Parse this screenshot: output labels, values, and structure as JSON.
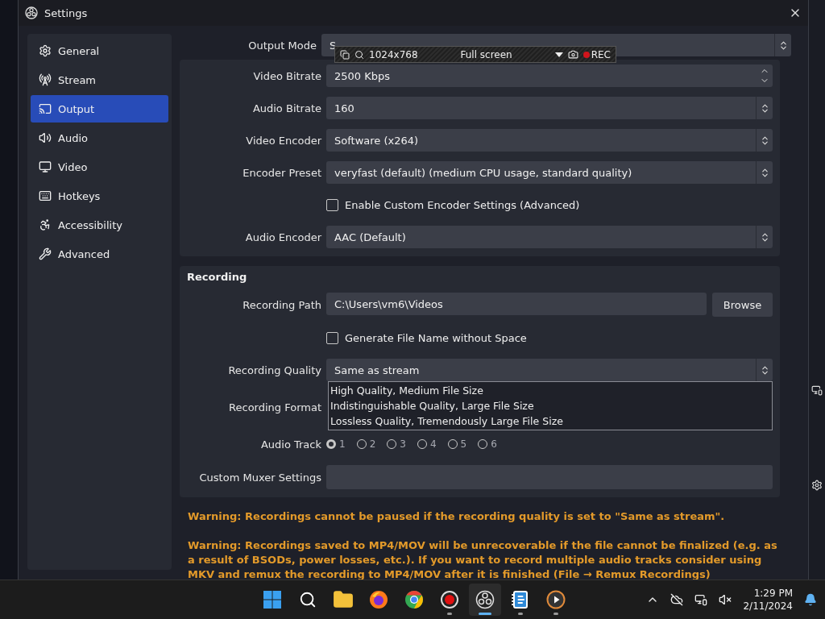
{
  "window": {
    "title": "Settings"
  },
  "sidebar": {
    "items": [
      {
        "label": "General",
        "selected": false
      },
      {
        "label": "Stream",
        "selected": false
      },
      {
        "label": "Output",
        "selected": true
      },
      {
        "label": "Audio",
        "selected": false
      },
      {
        "label": "Video",
        "selected": false
      },
      {
        "label": "Hotkeys",
        "selected": false
      },
      {
        "label": "Accessibility",
        "selected": false
      },
      {
        "label": "Advanced",
        "selected": false
      }
    ]
  },
  "output_mode": {
    "label": "Output Mode",
    "value": "S"
  },
  "streaming": {
    "rows": [
      {
        "kind": "spin",
        "label": "Video Bitrate",
        "value": "2500 Kbps"
      },
      {
        "kind": "select",
        "label": "Audio Bitrate",
        "value": "160"
      },
      {
        "kind": "select",
        "label": "Video Encoder",
        "value": "Software (x264)"
      },
      {
        "kind": "select",
        "label": "Encoder Preset",
        "value": "veryfast (default) (medium CPU usage, standard quality)"
      },
      {
        "kind": "checkbox",
        "label": "Enable Custom Encoder Settings (Advanced)",
        "checked": false
      },
      {
        "kind": "select",
        "label": "Audio Encoder",
        "value": "AAC (Default)"
      }
    ]
  },
  "recording": {
    "title": "Recording",
    "rows": [
      {
        "kind": "path",
        "label": "Recording Path",
        "value": "C:\\Users\\vm6\\Videos",
        "button": "Browse"
      },
      {
        "kind": "checkbox",
        "label": "Generate File Name without Space",
        "checked": false
      },
      {
        "kind": "select",
        "label": "Recording Quality",
        "value": "Same as stream",
        "expanded": true,
        "options": [
          "High Quality, Medium File Size",
          "Indistinguishable Quality, Large File Size",
          "Lossless Quality, Tremendously Large File Size"
        ]
      },
      {
        "kind": "covered",
        "label": "Recording Format"
      },
      {
        "kind": "radios",
        "label": "Audio Track",
        "options": [
          {
            "label": "1",
            "selected": true
          },
          {
            "label": "2",
            "selected": false
          },
          {
            "label": "3",
            "selected": false
          },
          {
            "label": "4",
            "selected": false
          },
          {
            "label": "5",
            "selected": false
          },
          {
            "label": "6",
            "selected": false
          }
        ]
      },
      {
        "kind": "text",
        "label": "Custom Muxer Settings"
      }
    ]
  },
  "warnings": [
    "Warning: Recordings cannot be paused if the recording quality is set to \"Same as stream\".",
    "Warning: Recordings saved to MP4/MOV will be unrecoverable if the file cannot be finalized (e.g. as a result of BSODs, power losses, etc.). If you want to record multiple audio tracks consider using MKV and remux the recording to MP4/MOV after it is finished (File → Remux Recordings)"
  ],
  "capture_bar": {
    "size": "1024x768",
    "mode": "Full screen",
    "rec": "REC"
  },
  "taskbar": {
    "apps": [
      {
        "running": false,
        "selected": false
      },
      {
        "running": false,
        "selected": false
      },
      {
        "running": false,
        "selected": false
      },
      {
        "running": false,
        "selected": false
      },
      {
        "running": false,
        "selected": false
      },
      {
        "running": true,
        "selected": false
      },
      {
        "running": true,
        "selected": true
      },
      {
        "running": true,
        "selected": false
      },
      {
        "running": true,
        "selected": false
      }
    ],
    "time": "1:29 PM",
    "date": "2/11/2024"
  }
}
